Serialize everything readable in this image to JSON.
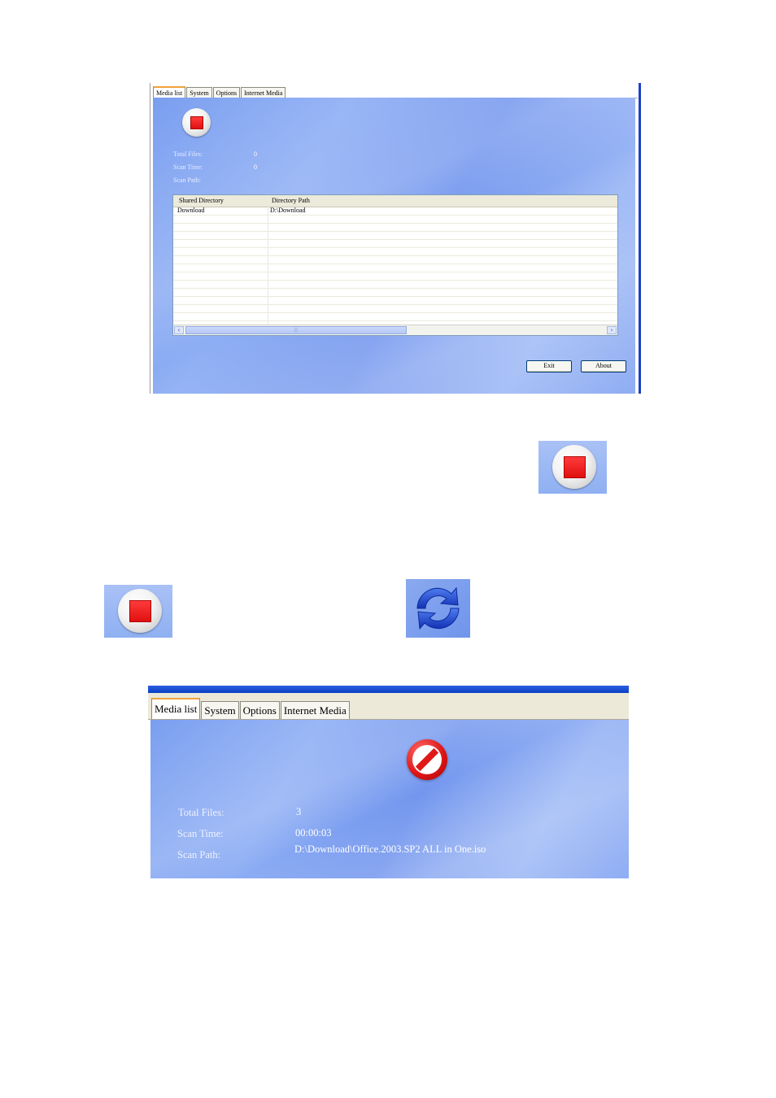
{
  "screenshot1": {
    "tabs": [
      "Media list",
      "System",
      "Options",
      "Internet Media"
    ],
    "labels": {
      "total_files": "Total Files:",
      "scan_time": "Scan Time:",
      "scan_path": "Scan Path:"
    },
    "values": {
      "total_files": "0",
      "scan_time": "0",
      "scan_path": ""
    },
    "table": {
      "columns": [
        "Shared Directory",
        "Directory Path"
      ],
      "rows": [
        {
          "shared": "Download",
          "path": "D:\\Download"
        }
      ]
    },
    "buttons": {
      "exit": "Exit",
      "about": "About"
    }
  },
  "screenshot2": {
    "tabs": [
      "Media list",
      "System",
      "Options",
      "Internet Media"
    ],
    "labels": {
      "total_files": "Total Files:",
      "scan_time": "Scan Time:",
      "scan_path": "Scan Path:"
    },
    "values": {
      "total_files": "3",
      "scan_time": "00:00:03",
      "scan_path": "D:\\Download\\Office.2003.SP2 ALL in One.iso"
    }
  },
  "icons": {
    "stop": "stop-icon",
    "refresh": "refresh-icon",
    "forbidden": "forbidden-icon"
  },
  "colors": {
    "panel_blue": "#7a9ef0",
    "stop_red": "#e01010",
    "tab_accent": "#f0a23c"
  }
}
